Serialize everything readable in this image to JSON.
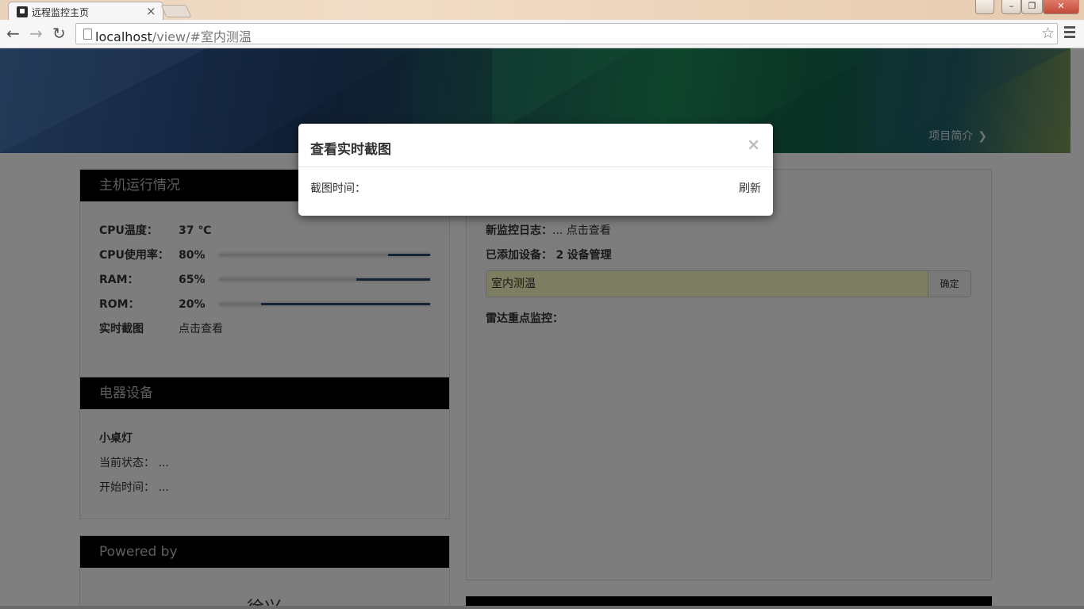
{
  "browser": {
    "tab_title": "远程监控主页",
    "tab_close": "×",
    "url_host": "localhost",
    "url_path": "/view/#室内测温",
    "window_controls": {
      "minimize": "▭",
      "maximize": "❐",
      "close": "✕",
      "user": "👤"
    }
  },
  "banner": {
    "link_label": "项目简介",
    "link_chevron": "❯"
  },
  "host_panel": {
    "title": "主机运行情况",
    "cpu_temp": {
      "label": "CPU温度：",
      "value": "37 ℃"
    },
    "cpu_usage": {
      "label": "CPU使用率：",
      "value": "80%",
      "level": 0.2
    },
    "ram": {
      "label": "RAM：",
      "value": "65%",
      "level": 0.35
    },
    "rom": {
      "label": "ROM：",
      "value": "20%",
      "level": 0.8
    },
    "screenshot": {
      "label": "实时截图",
      "link": "点击查看"
    }
  },
  "device_panel": {
    "title": "电器设备",
    "device_name": "小桌灯",
    "status": {
      "label": "当前状态：",
      "value": "..."
    },
    "start_time": {
      "label": "开始时间：",
      "value": "..."
    }
  },
  "powered_panel": {
    "title": "Powered by",
    "name": "徐兴"
  },
  "right_panel": {
    "log": {
      "label": "新监控日志：",
      "value": "... 点击查看"
    },
    "devices": {
      "label": "已添加设备：",
      "count": "2",
      "link": "设备管理"
    },
    "input_value": "室内测温",
    "confirm_button": "确定",
    "radar": {
      "label": "雷达重点监控："
    }
  },
  "modal": {
    "title": "查看实时截图",
    "close": "×",
    "time_label": "截图时间：",
    "refresh": "刷新"
  }
}
